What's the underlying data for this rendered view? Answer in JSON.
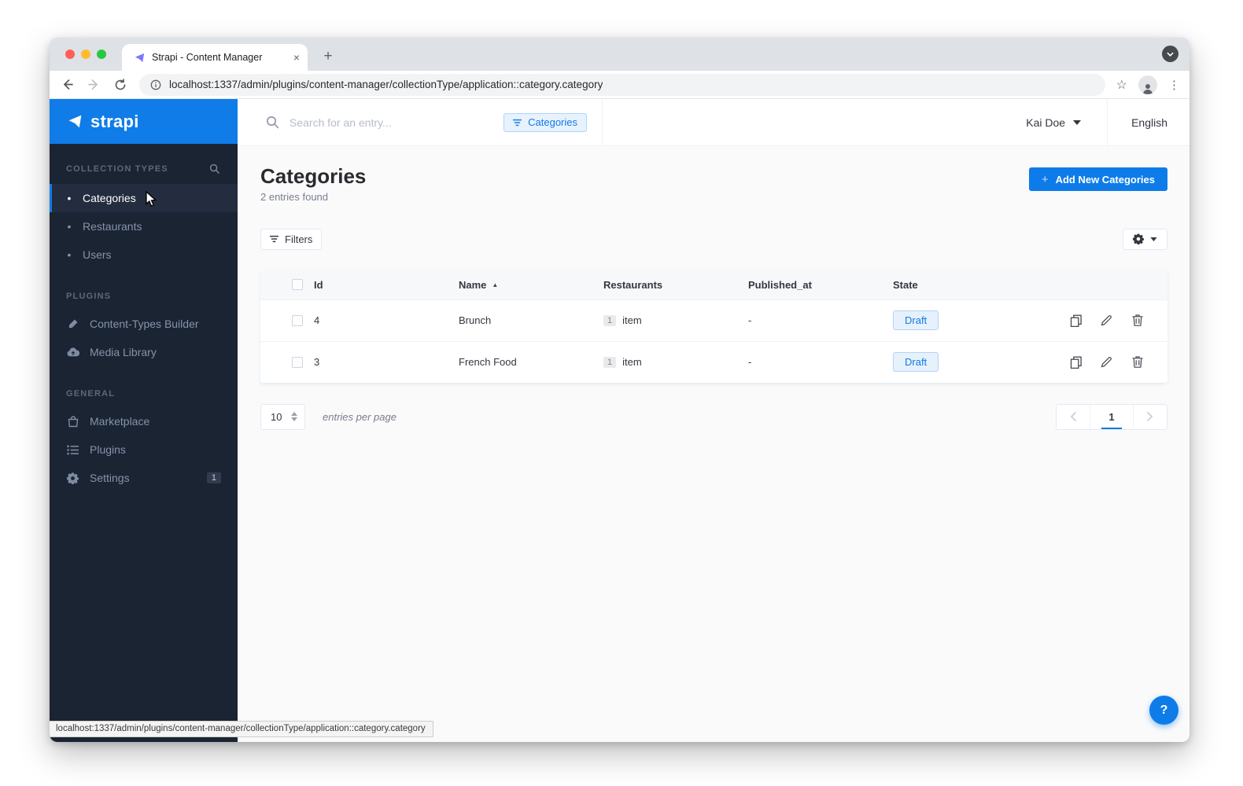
{
  "browser": {
    "tab_title": "Strapi - Content Manager",
    "url": "localhost:1337/admin/plugins/content-manager/collectionType/application::category.category"
  },
  "icons": {
    "close": "×",
    "plus": "+",
    "dots_menu": "⋮",
    "star": "☆",
    "bullet": "•",
    "sort_asc": "▲",
    "help": "?"
  },
  "sidebar": {
    "logo_text": "strapi",
    "collection_types": {
      "label": "COLLECTION TYPES",
      "active_item": "Categories",
      "items": [
        "Categories",
        "Restaurants",
        "Users"
      ]
    },
    "plugins_section": {
      "label": "PLUGINS",
      "items": [
        "Content-Types Builder",
        "Media Library"
      ]
    },
    "general_section": {
      "label": "GENERAL",
      "items": [
        "Marketplace",
        "Plugins",
        "Settings"
      ],
      "settings_badge": "1"
    }
  },
  "topbar": {
    "search_placeholder": "Search for an entry...",
    "filter_chip_label": "Categories",
    "user_name": "Kai Doe",
    "language_label": "English"
  },
  "page": {
    "title": "Categories",
    "entries_found": "2 entries found",
    "add_button_label": "Add New Categories",
    "filters_button_label": "Filters"
  },
  "table": {
    "headers": {
      "id": "Id",
      "name": "Name",
      "restaurants": "Restaurants",
      "published_at": "Published_at",
      "state": "State"
    },
    "sort": {
      "column": "Name",
      "direction": "asc"
    },
    "rows": [
      {
        "id": "4",
        "name": "Brunch",
        "restaurants_count": "1",
        "restaurants_unit": "item",
        "published_at": "-",
        "state": "Draft"
      },
      {
        "id": "3",
        "name": "French Food",
        "restaurants_count": "1",
        "restaurants_unit": "item",
        "published_at": "-",
        "state": "Draft"
      }
    ]
  },
  "pagination": {
    "per_page": "10",
    "per_page_label": "entries per page",
    "page": "1"
  },
  "status_bar": {
    "link_url": "localhost:1337/admin/plugins/content-manager/collectionType/application::category.category"
  },
  "colors": {
    "accent_blue": "#0e7ce8",
    "sidebar_bg": "#1b2433",
    "header_blue": "#0f7ce8",
    "content_bg": "#fafafb",
    "draft_badge_bg": "#e7f1fc",
    "draft_badge_border": "#aed4fb",
    "tabstrip_bg": "#dee1e6"
  }
}
